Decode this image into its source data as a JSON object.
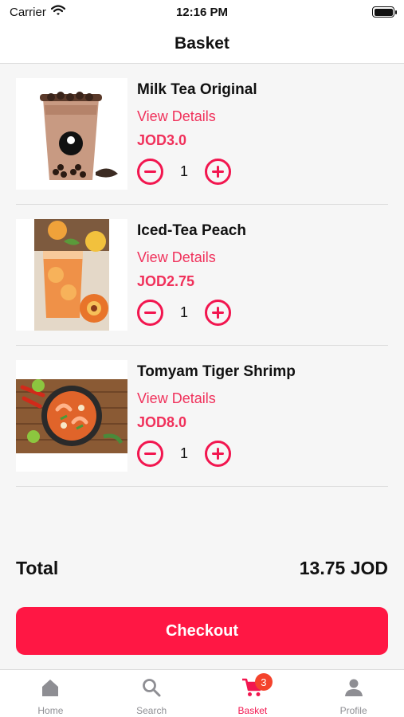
{
  "status_bar": {
    "carrier": "Carrier",
    "time": "12:16 PM"
  },
  "header": {
    "title": "Basket"
  },
  "items": [
    {
      "name": "Milk Tea Original",
      "details": "View Details",
      "price": "JOD3.0",
      "quantity": "1",
      "image": "milk-tea-cup-image"
    },
    {
      "name": "Iced-Tea Peach",
      "details": "View Details",
      "price": "JOD2.75",
      "quantity": "1",
      "image": "iced-tea-peach-image"
    },
    {
      "name": "Tomyam Tiger Shrimp",
      "details": "View Details",
      "price": "JOD8.0",
      "quantity": "1",
      "image": "tomyam-soup-image"
    }
  ],
  "summary": {
    "total_label": "Total",
    "total_value": "13.75 JOD"
  },
  "checkout": {
    "label": "Checkout"
  },
  "tabs": [
    {
      "label": "Home",
      "icon": "home-icon",
      "active": false
    },
    {
      "label": "Search",
      "icon": "search-icon",
      "active": false
    },
    {
      "label": "Basket",
      "icon": "cart-icon",
      "active": true,
      "badge": "3"
    },
    {
      "label": "Profile",
      "icon": "person-icon",
      "active": false
    }
  ],
  "colors": {
    "accent": "#ff1744",
    "text": "#111111",
    "inactive": "#8e8e93",
    "badge": "#f4432c",
    "background": "#f6f6f6"
  }
}
